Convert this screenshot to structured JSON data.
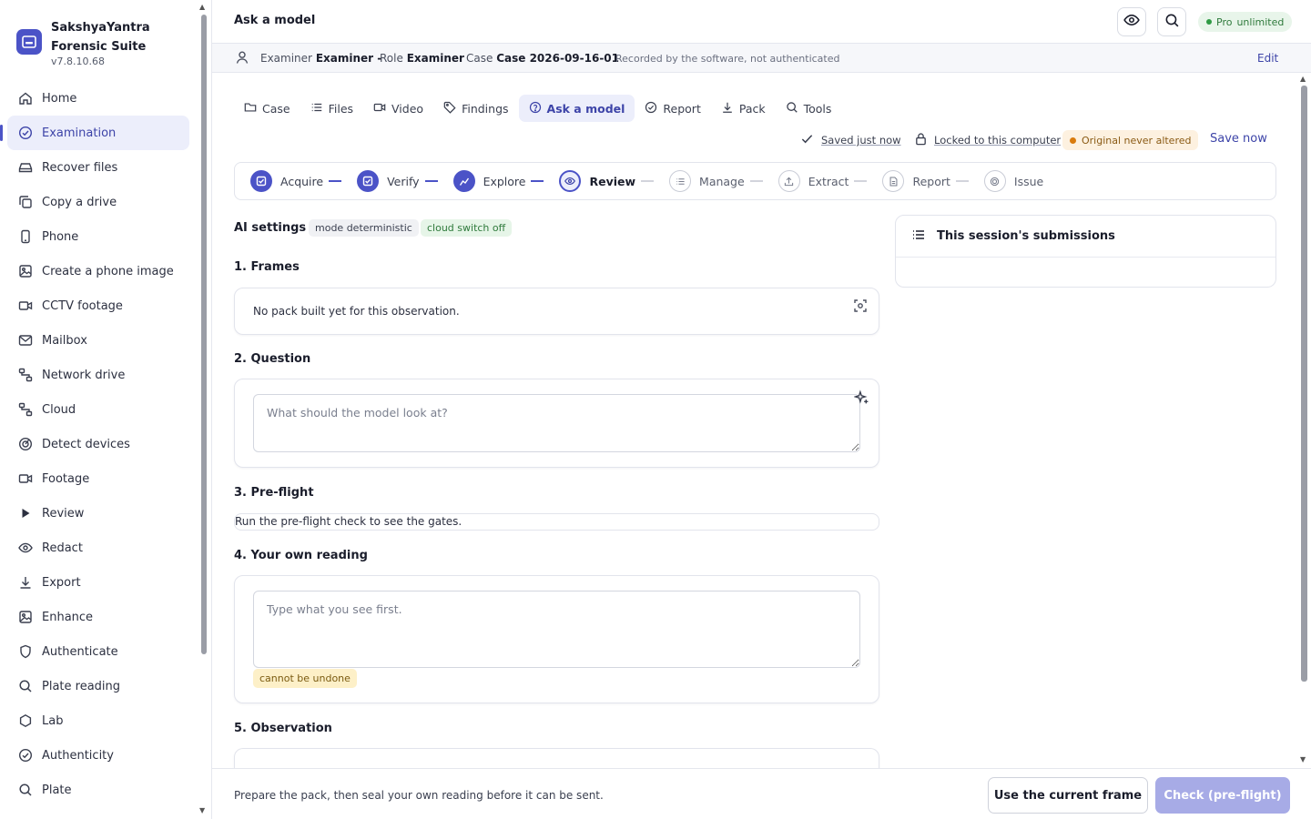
{
  "app": {
    "name_line1": "SakshyaYantra",
    "name_line2": "Forensic Suite",
    "version": "v7.8.10.68"
  },
  "sidebar": {
    "items": [
      {
        "label": "Home",
        "icon": "home-icon"
      },
      {
        "label": "Examination",
        "icon": "check-circle-icon",
        "active": true
      },
      {
        "label": "Recover files",
        "icon": "drive-icon"
      },
      {
        "label": "Copy a drive",
        "icon": "copy-icon"
      },
      {
        "label": "Phone",
        "icon": "phone-icon"
      },
      {
        "label": "Create a phone image",
        "icon": "image-icon"
      },
      {
        "label": "CCTV footage",
        "icon": "video-icon"
      },
      {
        "label": "Mailbox",
        "icon": "mail-icon"
      },
      {
        "label": "Network drive",
        "icon": "network-icon"
      },
      {
        "label": "Cloud",
        "icon": "network-icon"
      },
      {
        "label": "Detect devices",
        "icon": "detect-icon"
      },
      {
        "label": "Footage",
        "icon": "video-icon"
      },
      {
        "label": "Review",
        "icon": "play-icon"
      },
      {
        "label": "Redact",
        "icon": "eye-icon"
      },
      {
        "label": "Export",
        "icon": "download-icon"
      },
      {
        "label": "Enhance",
        "icon": "image-icon"
      },
      {
        "label": "Authenticate",
        "icon": "shield-icon"
      },
      {
        "label": "Plate reading",
        "icon": "search-icon"
      },
      {
        "label": "Lab",
        "icon": "lab-icon"
      },
      {
        "label": "Authenticity",
        "icon": "check-circle-icon"
      },
      {
        "label": "Plate",
        "icon": "search-icon"
      }
    ]
  },
  "topbar": {
    "title": "Ask a model",
    "pro_label": "Pro",
    "pro_value": "unlimited"
  },
  "infobar": {
    "examiner_label": "Examiner",
    "examiner_value": "Examiner -",
    "role_label": "Role",
    "role_value": "Examiner",
    "case_label": "Case",
    "case_value": "Case 2026-09-16-01",
    "note": "Recorded by the software, not authenticated",
    "edit_label": "Edit"
  },
  "tabs": [
    {
      "label": "Case",
      "icon": "folder-icon"
    },
    {
      "label": "Files",
      "icon": "list-icon"
    },
    {
      "label": "Video",
      "icon": "video-icon"
    },
    {
      "label": "Findings",
      "icon": "tag-icon"
    },
    {
      "label": "Ask a model",
      "icon": "help-circle-icon",
      "active": true
    },
    {
      "label": "Report",
      "icon": "check-circle-icon"
    },
    {
      "label": "Pack",
      "icon": "download-icon"
    },
    {
      "label": "Tools",
      "icon": "search-icon"
    }
  ],
  "status": {
    "saved": "Saved just now",
    "locked": "Locked to this computer",
    "original": "Original never altered",
    "save_now": "Save now"
  },
  "steps": [
    {
      "label": "Acquire",
      "state": "done"
    },
    {
      "label": "Verify",
      "state": "done"
    },
    {
      "label": "Explore",
      "state": "done"
    },
    {
      "label": "Review",
      "state": "current"
    },
    {
      "label": "Manage",
      "state": "todo"
    },
    {
      "label": "Extract",
      "state": "todo"
    },
    {
      "label": "Report",
      "state": "todo"
    },
    {
      "label": "Issue",
      "state": "todo"
    }
  ],
  "ai_settings": {
    "title": "AI settings",
    "mode_chip": "mode deterministic",
    "cloud_chip": "cloud switch off"
  },
  "frames": {
    "title": "1. Frames",
    "empty_text": "No pack built yet for this observation."
  },
  "question": {
    "title": "2. Question",
    "value": "",
    "placeholder": "What should the model look at?"
  },
  "preflight": {
    "title": "3. Pre-flight",
    "text": "Run the pre-flight check to see the gates."
  },
  "reading": {
    "title": "4. Your own reading",
    "value": "",
    "placeholder": "Type what you see first.",
    "warning": "cannot be undone"
  },
  "observation": {
    "title": "5. Observation"
  },
  "submissions": {
    "title": "This session's submissions"
  },
  "footer": {
    "message": "Prepare the pack, then seal your own reading before it can be sent.",
    "use_frame_label": "Use the current frame",
    "check_label": "Check (pre-flight)"
  },
  "colors": {
    "accent": "#4b53c7",
    "accent_soft": "#eceefb",
    "success": "#2f9a44",
    "warning": "#d97b0d",
    "primary_disabled": "#a7abe6"
  }
}
